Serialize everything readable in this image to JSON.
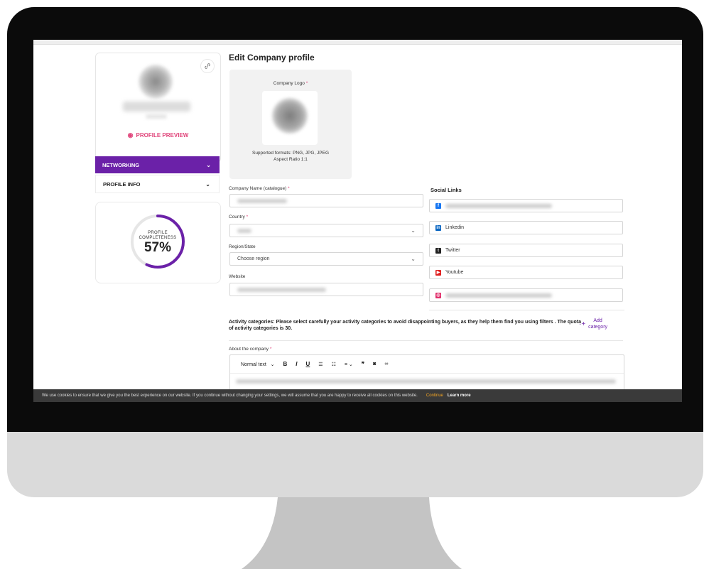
{
  "sidebar": {
    "preview_label": "PROFILE PREVIEW",
    "nav": [
      {
        "label": "NETWORKING",
        "active": true
      },
      {
        "label": "PROFILE INFO",
        "active": false
      }
    ],
    "completeness": {
      "label_line1": "PROFILE",
      "label_line2": "COMPLETENESS",
      "value_text": "57%",
      "value": 0.57
    }
  },
  "main": {
    "title": "Edit Company profile",
    "logo": {
      "label": "Company Logo",
      "required_mark": "*",
      "formats": "Supported formats: PNG, JPG, JPEG",
      "ratio": "Aspect Ratio 1:1"
    },
    "fields": {
      "company_name": {
        "label": "Company Name (catalogue)",
        "required_mark": "*"
      },
      "country": {
        "label": "Country",
        "required_mark": "*"
      },
      "region": {
        "label": "Region/State",
        "placeholder": "Choose region"
      },
      "website": {
        "label": "Website"
      }
    },
    "social": {
      "title": "Social Links",
      "items": [
        {
          "network": "Facebook",
          "label": "",
          "color": "#1877f2",
          "glyph": "f"
        },
        {
          "network": "Linkedin",
          "label": "Linkedin",
          "color": "#0a66c2",
          "glyph": "in"
        },
        {
          "network": "Twitter",
          "label": "Twitter",
          "color": "#222222",
          "glyph": "t"
        },
        {
          "network": "Youtube",
          "label": "Youtube",
          "color": "#e02020",
          "glyph": "▶"
        },
        {
          "network": "Instagram",
          "label": "",
          "color": "#e1306c",
          "glyph": "◎"
        }
      ]
    },
    "activity": {
      "text": "Activity categories: Please select carefully your activity categories to avoid disappointing buyers, as they help them find you using filters . The quota of activity categories is 30.",
      "add_line1": "Add",
      "add_line2": "category"
    },
    "about": {
      "label": "About the company",
      "required_mark": "*",
      "toolbar": {
        "style": "Normal text",
        "bold": "B",
        "italic": "I",
        "underline": "U"
      }
    }
  },
  "cookie": {
    "text": "We use cookies to ensure that we give you the best experience on our website. If you continue without changing your settings, we will assume that you are happy to receive all cookies on this website.",
    "continue": "Continue",
    "learn_more": "Learn more"
  },
  "colors": {
    "accent": "#6b21a8",
    "pink": "#e0447a",
    "cookie_bg": "#3a3a3a"
  }
}
